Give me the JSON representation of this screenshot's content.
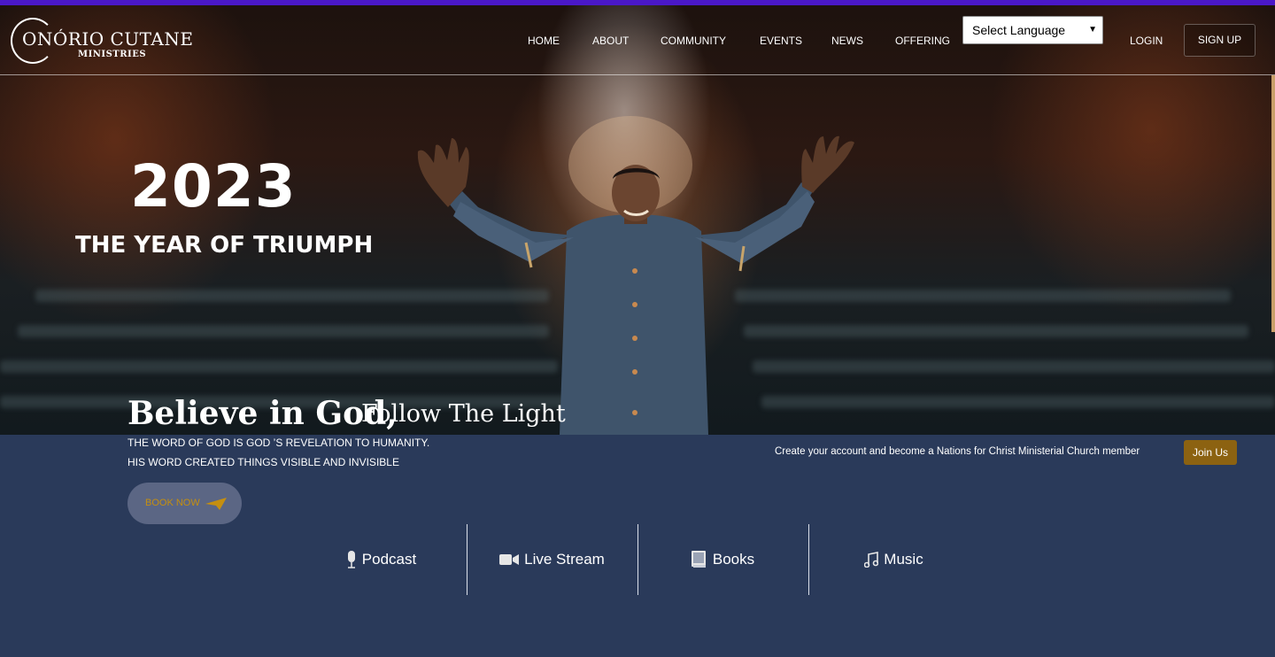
{
  "brand": {
    "title": "ONÓRIO CUTANE",
    "subtitle": "MINISTRIES"
  },
  "nav": {
    "items": [
      {
        "label": "HOME"
      },
      {
        "label": "ABOUT"
      },
      {
        "label": "COMMUNITY"
      },
      {
        "label": "EVENTS"
      },
      {
        "label": "NEWS"
      },
      {
        "label": "OFFERING"
      }
    ],
    "language_select": "Select Language",
    "login": "LOGIN",
    "signup": "SIGN UP"
  },
  "hero": {
    "year": "2023",
    "tagline": "THE YEAR OF TRIUMPH",
    "headline_bold": "Believe in God,",
    "headline_light": "Follow The Light",
    "desc_line1": "THE WORD OF GOD IS GOD ’S REVELATION TO HUMANITY.",
    "desc_line2": "HIS WORD CREATED THINGS VISIBLE AND INVISIBLE",
    "book_button": "BOOK NOW"
  },
  "join": {
    "text": "Create your account and become a Nations for Christ Ministerial Church member",
    "button": "Join Us"
  },
  "features": [
    {
      "label": "Podcast",
      "icon": "microphone-icon"
    },
    {
      "label": "Live Stream",
      "icon": "video-camera-icon"
    },
    {
      "label": "Books",
      "icon": "book-icon"
    },
    {
      "label": "Music",
      "icon": "music-note-icon"
    }
  ],
  "colors": {
    "top_accent": "#4a18c8",
    "panel_bg": "#2a3a5a",
    "gold": "#8c6211",
    "book_text": "#c58f10"
  }
}
